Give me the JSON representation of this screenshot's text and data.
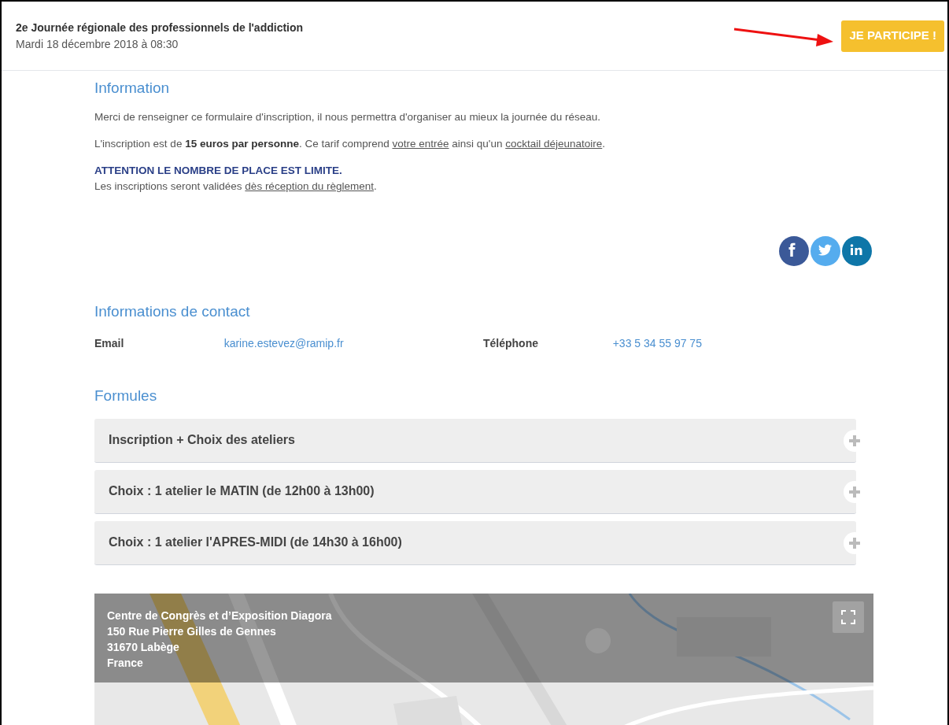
{
  "header": {
    "title": "2e Journée régionale des professionnels de l'addiction",
    "date": "Mardi 18 décembre 2018 à 08:30",
    "button": "JE PARTICIPE !",
    "annotation_arrow": true
  },
  "information": {
    "heading": "Information",
    "paragraphs": [
      [
        {
          "kind": "plain",
          "text": "Merci de renseigner ce formulaire d'inscription, il nous permettra d'organiser au mieux la journée du réseau."
        }
      ],
      [
        {
          "kind": "plain",
          "text": "L'inscription est de "
        },
        {
          "kind": "bold",
          "text": "15 euros par personne"
        },
        {
          "kind": "plain",
          "text": ". Ce tarif comprend "
        },
        {
          "kind": "link",
          "text": "votre entrée"
        },
        {
          "kind": "plain",
          "text": " ainsi qu'un "
        },
        {
          "kind": "link",
          "text": "cocktail déjeunatoire"
        },
        {
          "kind": "plain",
          "text": "."
        }
      ]
    ],
    "warning": "ATTENTION LE NOMBRE DE PLACE EST LIMITE.",
    "note": [
      {
        "kind": "plain",
        "text": "Les inscriptions seront validées "
      },
      {
        "kind": "link",
        "text": "dès réception du règlement"
      },
      {
        "kind": "plain",
        "text": "."
      }
    ]
  },
  "social": [
    {
      "kind": "facebook",
      "color": "#3b5998"
    },
    {
      "kind": "twitter",
      "color": "#55acee"
    },
    {
      "kind": "linkedin",
      "color": "#0e76a8"
    }
  ],
  "contact": {
    "heading": "Informations de contact",
    "fields": [
      {
        "label": "Email",
        "value": "karine.estevez@ramip.fr"
      },
      {
        "label": "Téléphone",
        "value": "+33 5 34 55 97 75"
      }
    ]
  },
  "formules": {
    "heading": "Formules",
    "items": [
      {
        "label": "Inscription + Choix des ateliers",
        "expanded": false
      },
      {
        "label": "Choix : 1 atelier le MATIN (de 12h00 à 13h00)",
        "expanded": false
      },
      {
        "label": "Choix : 1 atelier l'APRES-MIDI (de 14h30 à 16h00)",
        "expanded": false
      }
    ]
  },
  "map": {
    "kind": "picture",
    "address": [
      "Centre de Congrès et d’Exposition Diagora",
      "150 Rue Pierre Gilles de Gennes",
      "31670 Labège",
      "France"
    ]
  }
}
